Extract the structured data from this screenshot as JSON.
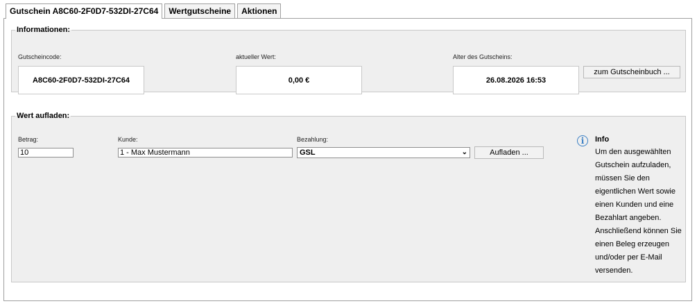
{
  "tabs": [
    {
      "label": "Gutschein A8C60-2F0D7-532DI-27C64",
      "active": true
    },
    {
      "label": "Wertgutscheine",
      "active": false
    },
    {
      "label": "Aktionen",
      "active": false
    }
  ],
  "informationen": {
    "legend": "Informationen:",
    "code_label": "Gutscheincode:",
    "code_value": "A8C60-2F0D7-532DI-27C64",
    "wert_label": "aktueller Wert:",
    "wert_value": "0,00 €",
    "alter_label": "Alter des Gutscheins:",
    "alter_value": "26.08.2026 16:53",
    "gutscheinbuch_button": "zum Gutscheinbuch ..."
  },
  "aufladen": {
    "legend": "Wert aufladen:",
    "betrag_label": "Betrag:",
    "betrag_value": "10",
    "kunde_label": "Kunde:",
    "kunde_value": "1 - Max Mustermann",
    "bezahlung_label": "Bezahlung:",
    "bezahlung_value": "GSL",
    "aufladen_button": "Aufladen ..."
  },
  "info": {
    "icon": "info-icon",
    "title": "Info",
    "text": "Um den ausgewählten Gutschein aufzuladen, müssen Sie den eigentlichen Wert sowie einen Kunden und eine Bezahlart angeben. Anschließend können Sie einen Beleg erzeugen und/oder per E-Mail versenden."
  },
  "colors": {
    "info_accent": "#3a7fc4",
    "fieldset_bg": "#efefef"
  }
}
